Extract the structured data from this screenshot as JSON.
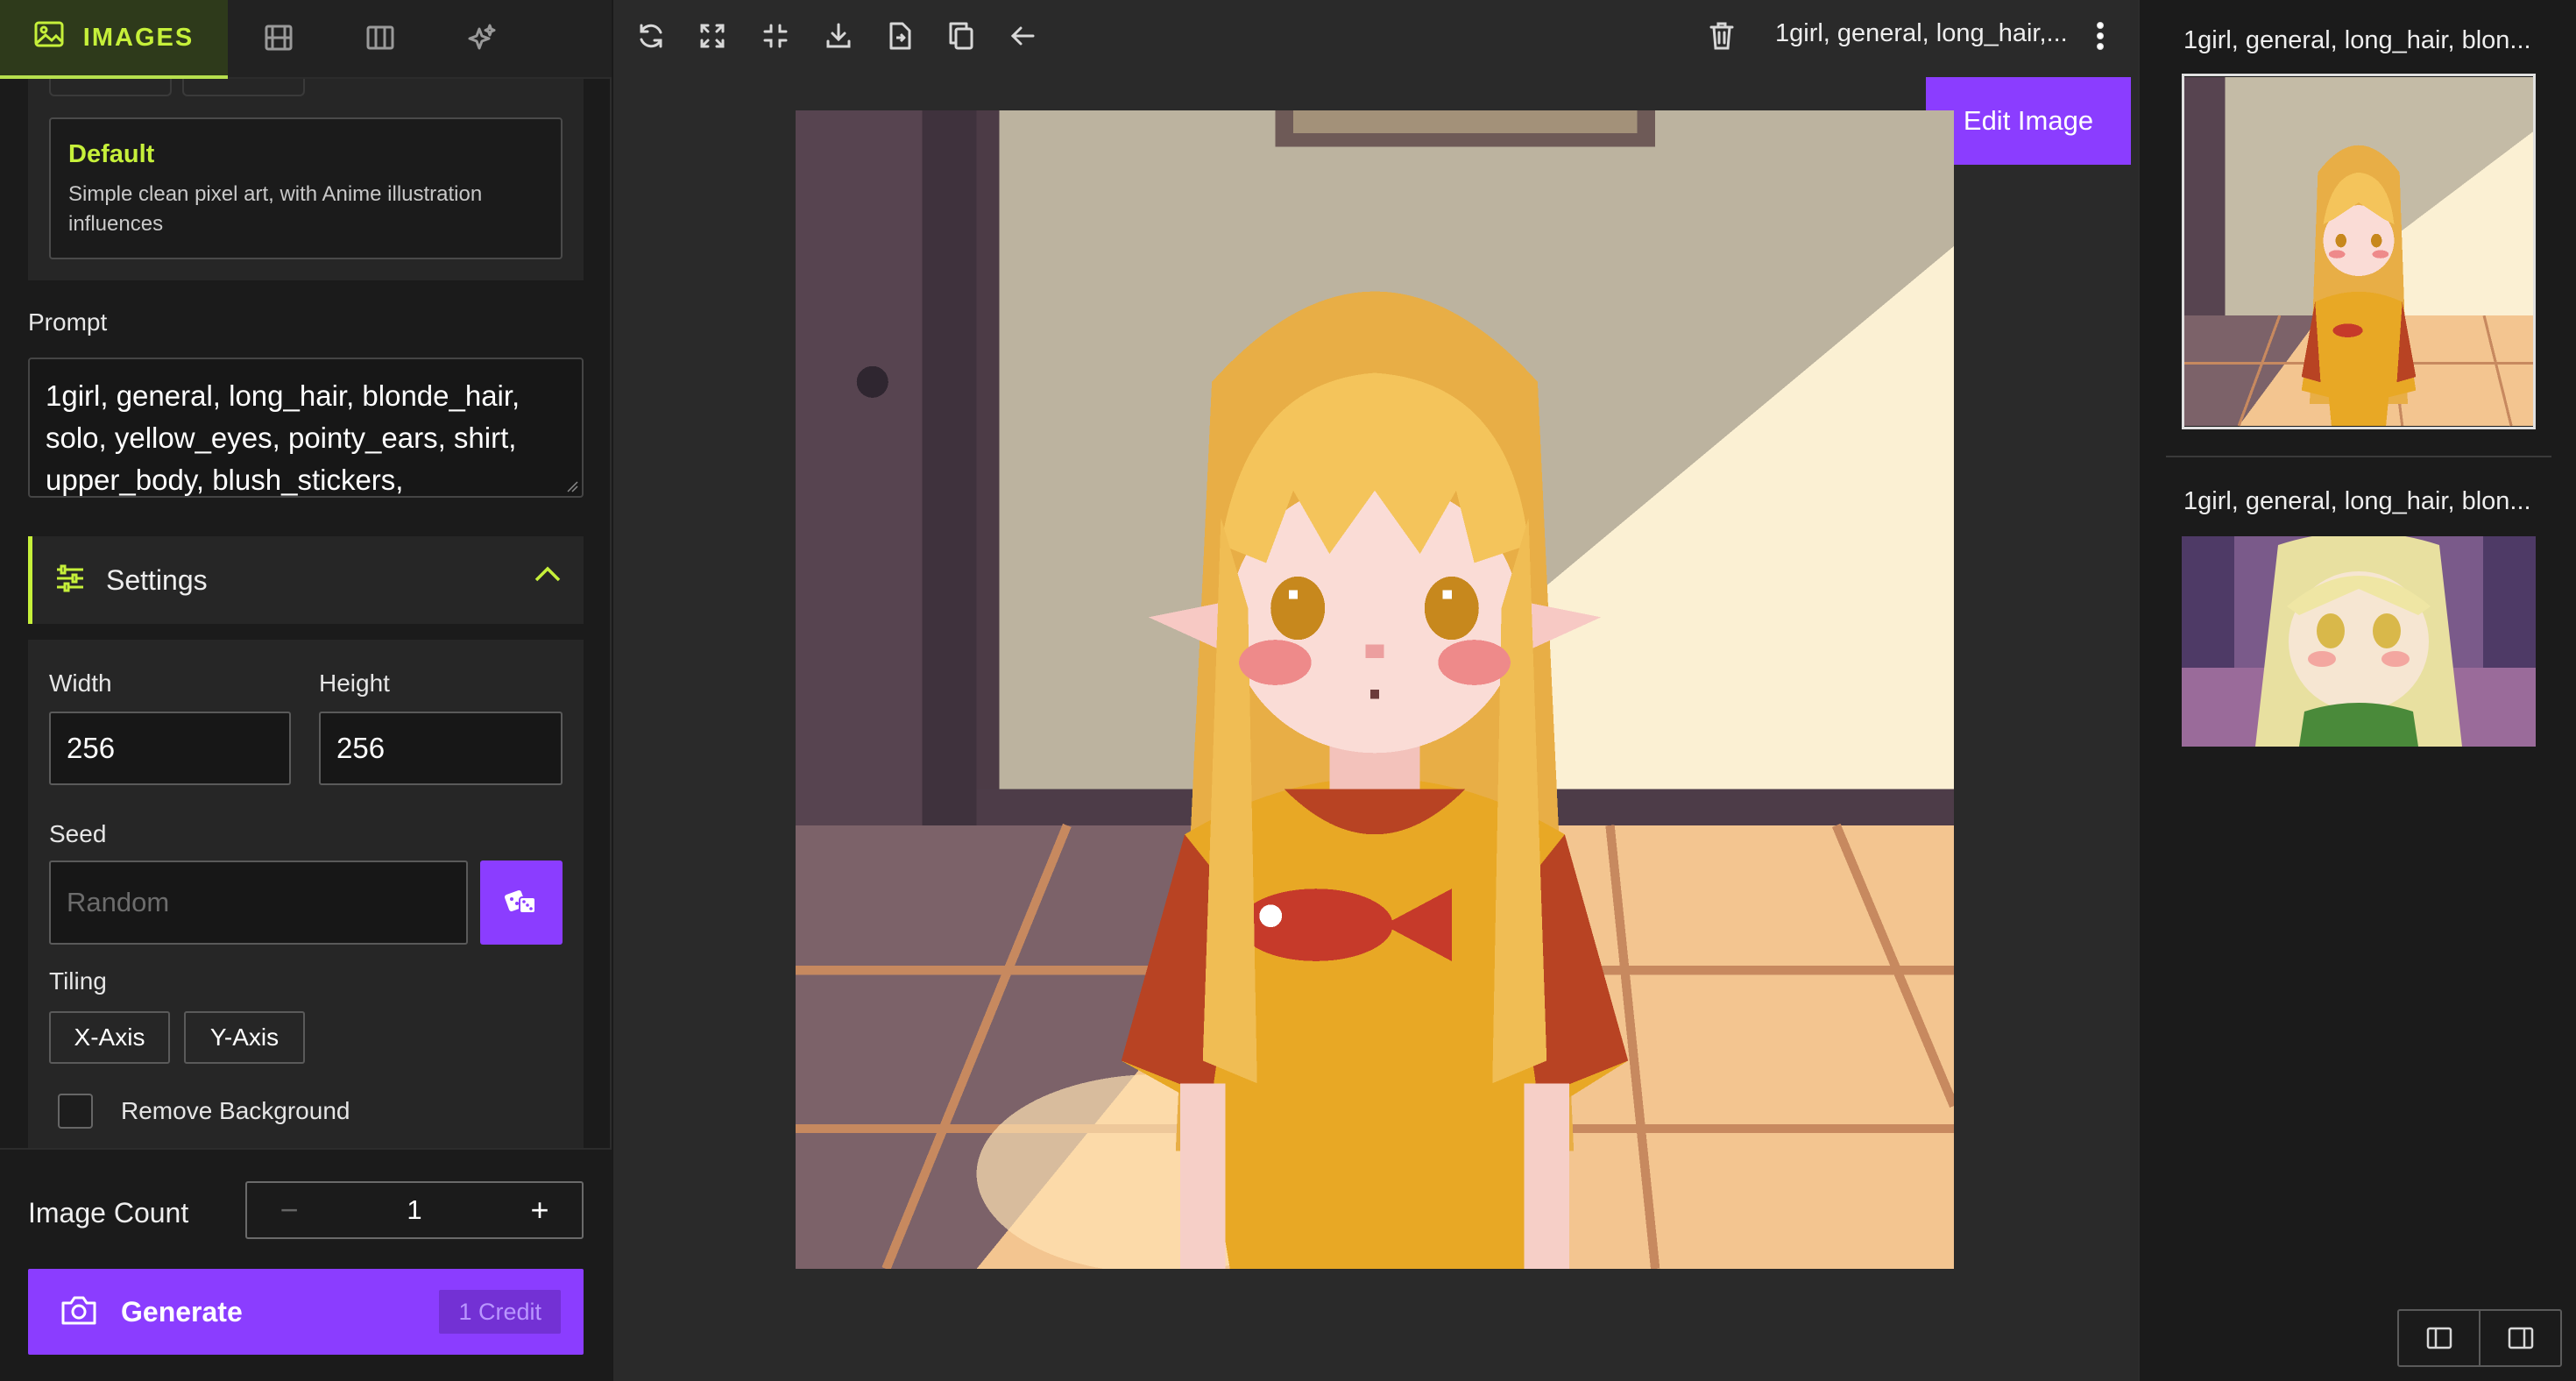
{
  "tabs": {
    "images_label": "IMAGES"
  },
  "style": {
    "name": "Default",
    "description": "Simple clean pixel art, with Anime illustration influences"
  },
  "prompt": {
    "label": "Prompt",
    "value": "1girl, general, long_hair, blonde_hair, solo, yellow_eyes, pointy_ears, shirt, upper_body, blush_stickers,"
  },
  "settings": {
    "title": "Settings",
    "width_label": "Width",
    "width_value": "256",
    "height_label": "Height",
    "height_value": "256",
    "seed_label": "Seed",
    "seed_placeholder": "Random",
    "tiling_label": "Tiling",
    "tiling_x": "X-Axis",
    "tiling_y": "Y-Axis",
    "remove_background_label": "Remove Background"
  },
  "footer": {
    "image_count_label": "Image Count",
    "image_count_value": "1",
    "minus": "−",
    "plus": "+",
    "generate_label": "Generate",
    "credit_label": "1 Credit"
  },
  "toolbar": {
    "title": "1girl, general, long_hair,...",
    "edit_label": "Edit Image"
  },
  "history": [
    {
      "title": "1girl, general, long_hair, blon..."
    },
    {
      "title": "1girl, general, long_hair, blon..."
    }
  ],
  "colors": {
    "accent_lime": "#c6f03a",
    "accent_purple": "#8b3dff",
    "panel_bg": "#1b1b1b",
    "canvas_bg": "#2a2a2a"
  },
  "icons": {
    "tabs": [
      "image-icon",
      "film-icon",
      "columns-icon",
      "sparkles-icon"
    ],
    "toolbar": [
      "refresh-icon",
      "expand-icon",
      "collapse-icon",
      "download-icon",
      "file-export-icon",
      "copy-icon",
      "arrow-left-icon",
      "trash-icon",
      "more-vertical-icon"
    ],
    "settings": "sliders-icon",
    "seed": "dice-icon",
    "generate": "camera-icon",
    "layout": [
      "panel-left-icon",
      "panel-right-icon"
    ]
  }
}
